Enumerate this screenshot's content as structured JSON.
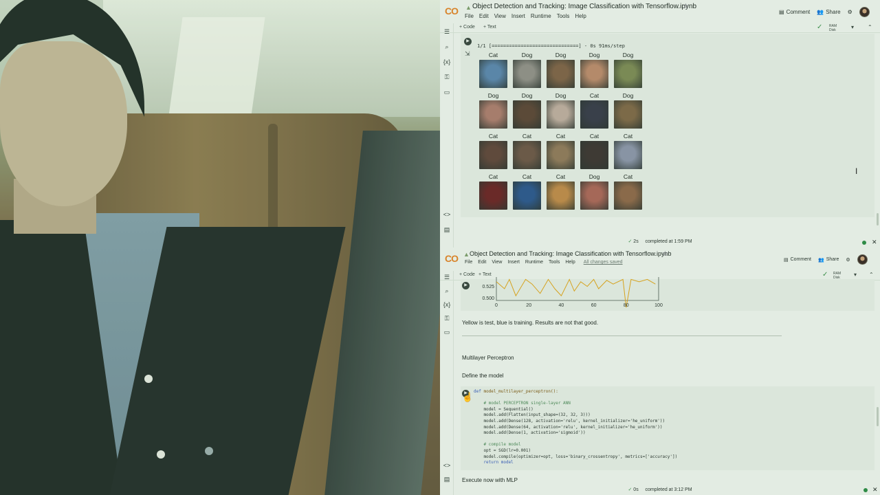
{
  "top": {
    "logo": "CO",
    "title": "Object Detection and Tracking: Image Classification with Tensorflow.ipynb",
    "menu": [
      "File",
      "Edit",
      "View",
      "Insert",
      "Runtime",
      "Tools",
      "Help"
    ],
    "comment": "Comment",
    "share": "Share",
    "add_code": "+ Code",
    "add_text": "+ Text",
    "ram": "RAM",
    "disk": "Disk",
    "progress_text": "1/1 [==============================] - 0s 91ms/step",
    "predictions": [
      [
        "Cat",
        "Dog",
        "Dog",
        "Dog",
        "Dog"
      ],
      [
        "Dog",
        "Dog",
        "Dog",
        "Cat",
        "Dog"
      ],
      [
        "Cat",
        "Cat",
        "Cat",
        "Cat",
        "Cat"
      ],
      [
        "Cat",
        "Cat",
        "Cat",
        "Dog",
        "Cat"
      ]
    ],
    "tile_colors": [
      [
        "#5a86a8",
        "#8d8f85",
        "#7c6548",
        "#b48a6a",
        "#7a8a55"
      ],
      [
        "#a67d6c",
        "#5b4a38",
        "#b7aa9a",
        "#39404a",
        "#7c6a48"
      ],
      [
        "#5f4a3c",
        "#6b5a48",
        "#8c7a5a",
        "#3e3a34",
        "#8894a4"
      ],
      [
        "#6a2a28",
        "#2e5a8a",
        "#b88a4a",
        "#a56858",
        "#8a6a4a"
      ]
    ],
    "status_duration": "2s",
    "status_text": "completed at 1:59 PM"
  },
  "bottom": {
    "logo": "CO",
    "title": "Object Detection and Tracking: Image Classification with Tensorflow.ipynb",
    "menu": [
      "File",
      "Edit",
      "View",
      "Insert",
      "Runtime",
      "Tools",
      "Help"
    ],
    "saved": "All changes saved",
    "comment": "Comment",
    "share": "Share",
    "add_code": "+ Code",
    "add_text": "+ Text",
    "ram": "RAM",
    "disk": "Disk",
    "chart_data": {
      "type": "line",
      "x": [
        0,
        5,
        8,
        12,
        18,
        22,
        27,
        32,
        36,
        40,
        45,
        48,
        52,
        56,
        60,
        63,
        68,
        72,
        78,
        80,
        83,
        88,
        93,
        98
      ],
      "y": [
        0.535,
        0.52,
        0.54,
        0.505,
        0.54,
        0.53,
        0.51,
        0.54,
        0.52,
        0.505,
        0.54,
        0.515,
        0.535,
        0.525,
        0.54,
        0.52,
        0.538,
        0.53,
        0.54,
        0.48,
        0.54,
        0.535,
        0.54,
        0.53
      ],
      "xticks": [
        "0",
        "20",
        "40",
        "60",
        "80",
        "100"
      ],
      "yticks": [
        "0.525",
        "0.500"
      ],
      "xlim": [
        0,
        100
      ],
      "ylim": [
        0.495,
        0.545
      ],
      "color": "#d6a21e"
    },
    "note": "Yellow is test, blue is training. Results are not that good.",
    "heading1": "Multilayer Perceptron",
    "heading2": "Define the model",
    "code_lines": [
      {
        "t": "def model_multilayer_perceptron():",
        "c": "kw"
      },
      {
        "t": "",
        "c": ""
      },
      {
        "t": "    # model PERCEPTRON single-layer ANN",
        "c": "cm"
      },
      {
        "t": "    model = Sequential()",
        "c": ""
      },
      {
        "t": "    model.add(Flatten(input_shape=(32, 32, 3)))",
        "c": ""
      },
      {
        "t": "    model.add(Dense(128, activation='relu', kernel_initializer='he_uniform'))",
        "c": ""
      },
      {
        "t": "    model.add(Dense(64, activation='relu', kernel_initializer='he_uniform'))",
        "c": ""
      },
      {
        "t": "    model.add(Dense(1, activation='sigmoid'))",
        "c": ""
      },
      {
        "t": "",
        "c": ""
      },
      {
        "t": "    # compile model",
        "c": "cm"
      },
      {
        "t": "    opt = SGD(lr=0.001)",
        "c": ""
      },
      {
        "t": "    model.compile(optimizer=opt, loss='binary_crossentropy', metrics=['accuracy'])",
        "c": ""
      },
      {
        "t": "    return model",
        "c": "kw"
      }
    ],
    "heading3": "Execute now with MLP",
    "status_duration": "0s",
    "status_text": "completed at 3:12 PM"
  }
}
